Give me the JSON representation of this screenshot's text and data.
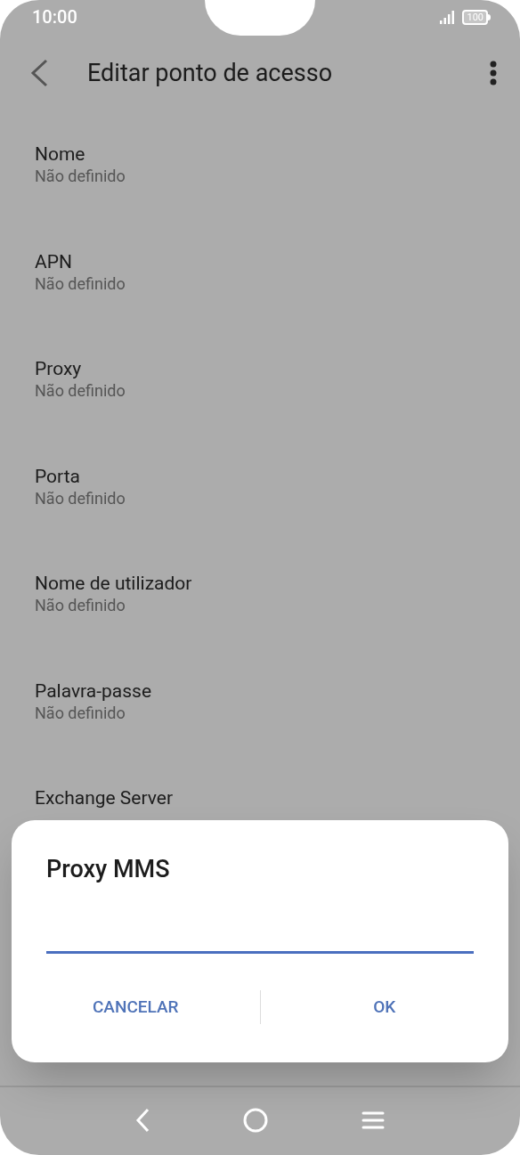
{
  "status_bar": {
    "time": "10:00",
    "battery": "100"
  },
  "header": {
    "title": "Editar ponto de acesso"
  },
  "settings": [
    {
      "label": "Nome",
      "value": "Não definido"
    },
    {
      "label": "APN",
      "value": "Não definido"
    },
    {
      "label": "Proxy",
      "value": "Não definido"
    },
    {
      "label": "Porta",
      "value": "Não definido"
    },
    {
      "label": "Nome de utilizador",
      "value": "Não definido"
    },
    {
      "label": "Palavra-passe",
      "value": "Não definido"
    },
    {
      "label": "Exchange Server"
    }
  ],
  "dialog": {
    "title": "Proxy MMS",
    "input": {
      "focused": true
    },
    "buttons": [
      {
        "label": "CANCELAR"
      },
      {
        "label": "OK"
      }
    ]
  }
}
